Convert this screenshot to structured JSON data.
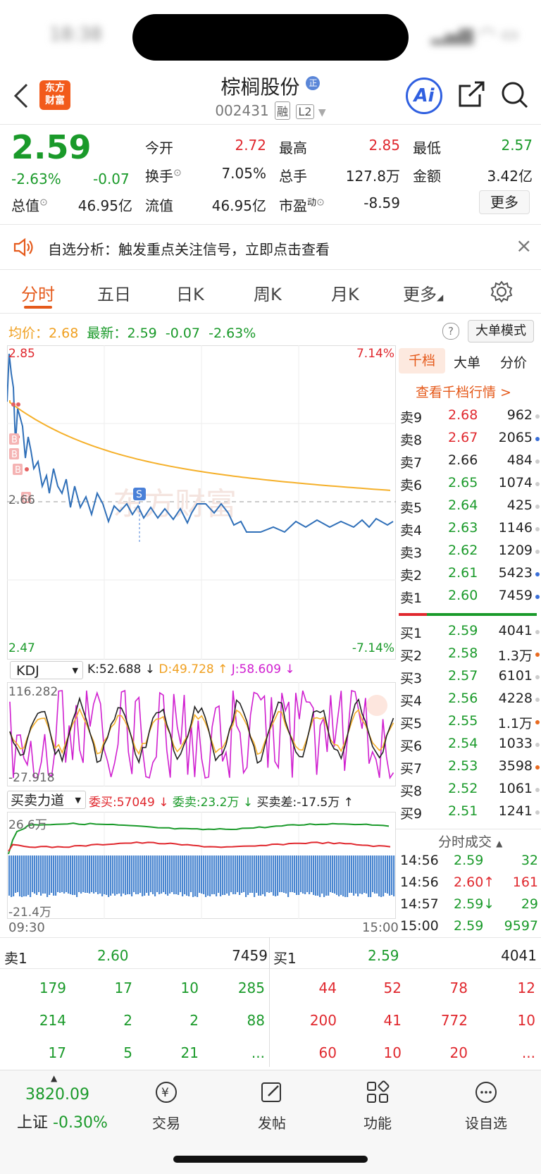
{
  "status": {
    "time": "18:38"
  },
  "header": {
    "back_icon": "chevron-left-icon",
    "logo_line1": "东方",
    "logo_line2": "财富",
    "stock_name": "棕榈股份",
    "badge": "正",
    "stock_code": "002431",
    "tag1": "融",
    "tag2": "L2",
    "ai_label": "Ai"
  },
  "quote": {
    "price": "2.59",
    "change_pct": "-2.63%",
    "change": "-0.07",
    "open_label": "今开",
    "open": "2.72",
    "high_label": "最高",
    "high": "2.85",
    "low_label": "最低",
    "low": "2.57",
    "turnover_label": "换手",
    "turnover": "7.05%",
    "volume_label": "总手",
    "volume": "127.8万",
    "amount_label": "金额",
    "amount": "3.42亿",
    "mcap_label": "总值",
    "mcap": "46.95亿",
    "float_label": "流值",
    "float": "46.95亿",
    "pe_label": "市盈",
    "pe_sup": "动",
    "pe": "-8.59",
    "more_button": "更多"
  },
  "banner": {
    "text": "自选分析：触发重点关注信号，立即点击查看",
    "close": "×"
  },
  "tabs": [
    "分时",
    "五日",
    "日K",
    "周K",
    "月K",
    "更多"
  ],
  "chart_header": {
    "avg_label": "均价：",
    "avg": "2.68",
    "latest_label": "最新：",
    "latest": "2.59",
    "latest_chg": "-0.07",
    "latest_pct": "-2.63%",
    "help": "?",
    "mode_button": "大单模式"
  },
  "price_chart": {
    "y_top": "2.85",
    "y_mid": "2.66",
    "y_bottom": "2.47",
    "pct_top": "7.14%",
    "pct_bottom": "-7.14%",
    "watermark": "东方财富",
    "marker_b": "B",
    "marker_s": "S",
    "time_start": "09:30",
    "time_end": "15:00"
  },
  "kdj": {
    "selector": "KDJ",
    "k": "K:52.688 ↓",
    "d": "D:49.728 ↑",
    "j": "J:58.609 ↓",
    "y_top": "116.282",
    "y_bottom": "-27.918"
  },
  "force": {
    "selector": "买卖力道",
    "wei_buy": "委买:57049 ↓",
    "wei_sell": "委卖:23.2万 ↓",
    "diff": "买卖差:-17.5万 ↑",
    "y_top": "26.6万",
    "y_bottom": "-21.4万"
  },
  "orderbook": {
    "tabs": [
      "千档",
      "大单",
      "分价"
    ],
    "link": "查看千档行情 >",
    "asks": [
      {
        "label": "卖9",
        "price": "2.68",
        "vol": "962"
      },
      {
        "label": "卖8",
        "price": "2.67",
        "vol": "2065"
      },
      {
        "label": "卖7",
        "price": "2.66",
        "vol": "484"
      },
      {
        "label": "卖6",
        "price": "2.65",
        "vol": "1074"
      },
      {
        "label": "卖5",
        "price": "2.64",
        "vol": "425"
      },
      {
        "label": "卖4",
        "price": "2.63",
        "vol": "1146"
      },
      {
        "label": "卖3",
        "price": "2.62",
        "vol": "1209"
      },
      {
        "label": "卖2",
        "price": "2.61",
        "vol": "5423"
      },
      {
        "label": "卖1",
        "price": "2.60",
        "vol": "7459"
      }
    ],
    "bids": [
      {
        "label": "买1",
        "price": "2.59",
        "vol": "4041"
      },
      {
        "label": "买2",
        "price": "2.58",
        "vol": "1.3万"
      },
      {
        "label": "买3",
        "price": "2.57",
        "vol": "6101"
      },
      {
        "label": "买4",
        "price": "2.56",
        "vol": "4228"
      },
      {
        "label": "买5",
        "price": "2.55",
        "vol": "1.1万"
      },
      {
        "label": "买6",
        "price": "2.54",
        "vol": "1033"
      },
      {
        "label": "买7",
        "price": "2.53",
        "vol": "3598"
      },
      {
        "label": "买8",
        "price": "2.52",
        "vol": "1061"
      },
      {
        "label": "买9",
        "price": "2.51",
        "vol": "1241"
      }
    ],
    "ticks_title": "分时成交",
    "ticks": [
      {
        "time": "14:56",
        "price": "2.59",
        "vol": "32"
      },
      {
        "time": "14:56",
        "price": "2.60↑",
        "vol": "161"
      },
      {
        "time": "14:57",
        "price": "2.59↓",
        "vol": "29"
      },
      {
        "time": "15:00",
        "price": "2.59",
        "vol": "9597"
      }
    ]
  },
  "queue": {
    "sell_label": "卖1",
    "sell_price": "2.60",
    "sell_vol": "7459",
    "buy_label": "买1",
    "buy_price": "2.59",
    "buy_vol": "4041",
    "sell_rows": [
      [
        "179",
        "17",
        "10",
        "285"
      ],
      [
        "214",
        "2",
        "2",
        "88"
      ],
      [
        "17",
        "5",
        "21",
        "..."
      ]
    ],
    "buy_rows": [
      [
        "44",
        "52",
        "78",
        "12"
      ],
      [
        "200",
        "41",
        "772",
        "10"
      ],
      [
        "60",
        "10",
        "20",
        "..."
      ]
    ]
  },
  "bottom_nav": {
    "index_value": "3820.09",
    "index_name": "上证",
    "index_change": "-0.30%",
    "items": [
      "交易",
      "发帖",
      "功能",
      "设自选"
    ]
  },
  "colors": {
    "up": "#e0282e",
    "down": "#1a9a2a",
    "accent": "#e55a1b",
    "price_line": "#2f6fb8",
    "avg_line": "#f5b02a"
  }
}
